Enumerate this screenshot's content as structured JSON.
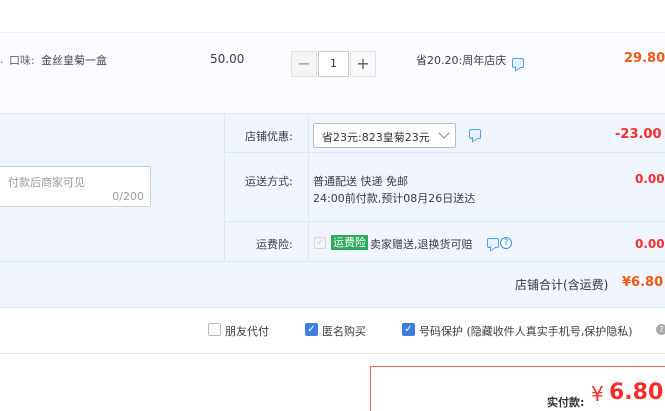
{
  "item": {
    "sku_label": "口味:",
    "sku_value": "金丝皇菊一盒",
    "unit_price": "50.00",
    "quantity": "1",
    "minus": "−",
    "plus": "+",
    "promo": "省20.20:周年店庆",
    "subtotal": "29.80"
  },
  "message": {
    "placeholder": "付款后商家可见",
    "counter": "0/200"
  },
  "shop_discount": {
    "label": "店铺优惠:",
    "selected": "省23元:823皇菊23元",
    "amount": "-23.00"
  },
  "shipping": {
    "label": "运送方式:",
    "method": "普通配送 快递 免邮",
    "eta": "24:00前付款,预计08月26日送达",
    "amount": "0.00"
  },
  "insurance": {
    "label": "运费险:",
    "badge": "运费险",
    "desc": "卖家赠送,退换货可赔",
    "help": "?",
    "amount": "0.00"
  },
  "shop_total": {
    "label": "店铺合计(含运费)",
    "value": "¥6.80"
  },
  "options": [
    {
      "label": "朋友代付",
      "checked": false
    },
    {
      "label": "匿名购买",
      "checked": true
    },
    {
      "label": "号码保护 (隐藏收件人真实手机号,保护隐私)",
      "checked": true
    }
  ],
  "payment": {
    "label": "实付款:",
    "currency": "¥",
    "amount": "6.80"
  },
  "colors": {
    "accent_red": "#ff2b2b",
    "accent_orange": "#f25812",
    "panel_bg": "#f1f6fe",
    "link_blue": "#3d7fe0",
    "insurance_green": "#2bab5a"
  },
  "icons": [
    "chat-icon",
    "chevron-down-icon",
    "help-icon",
    "check-icon",
    "info-icon"
  ]
}
